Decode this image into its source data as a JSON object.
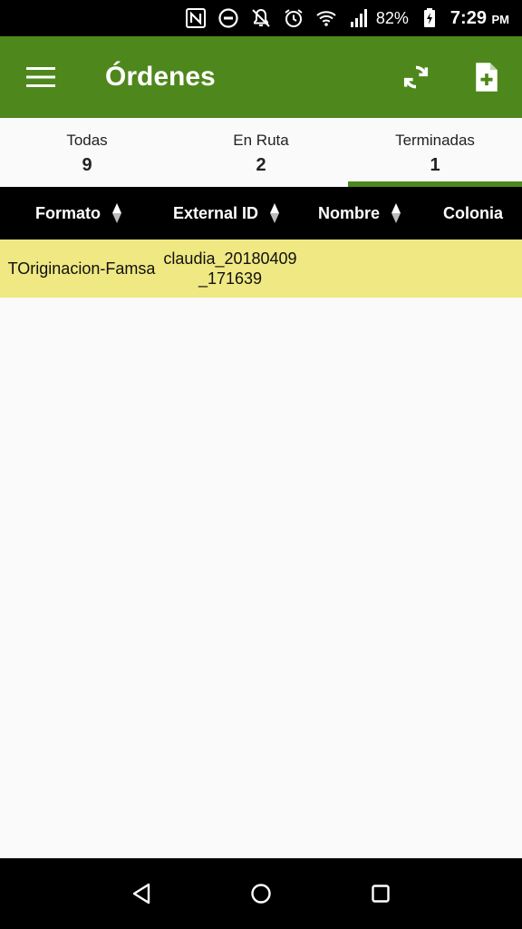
{
  "status_bar": {
    "battery": "82%",
    "time": "7:29",
    "ampm": "PM",
    "icons": [
      "nfc-icon",
      "do-not-disturb-icon",
      "notifications-off-icon",
      "alarm-icon",
      "wifi-icon",
      "signal-icon",
      "battery-charging-icon"
    ]
  },
  "app_bar": {
    "title": "Órdenes",
    "menu_icon": "menu-icon",
    "actions": [
      "refresh-icon",
      "add-document-icon"
    ],
    "color": "#4e871c"
  },
  "tabs": [
    {
      "label": "Todas",
      "count": "9"
    },
    {
      "label": "En Ruta",
      "count": "2"
    },
    {
      "label": "Terminadas",
      "count": "1",
      "active": true
    }
  ],
  "table": {
    "columns": [
      "Formato",
      "External ID",
      "Nombre",
      "Colonia"
    ],
    "rows": [
      {
        "formato": "TOriginacion-Famsa",
        "external_id": "claudia_20180409_171639",
        "nombre": "",
        "colonia": ""
      }
    ],
    "row_color": "#f0e882"
  },
  "nav_bar": {
    "buttons": [
      "back-icon",
      "home-icon",
      "recents-icon"
    ]
  }
}
